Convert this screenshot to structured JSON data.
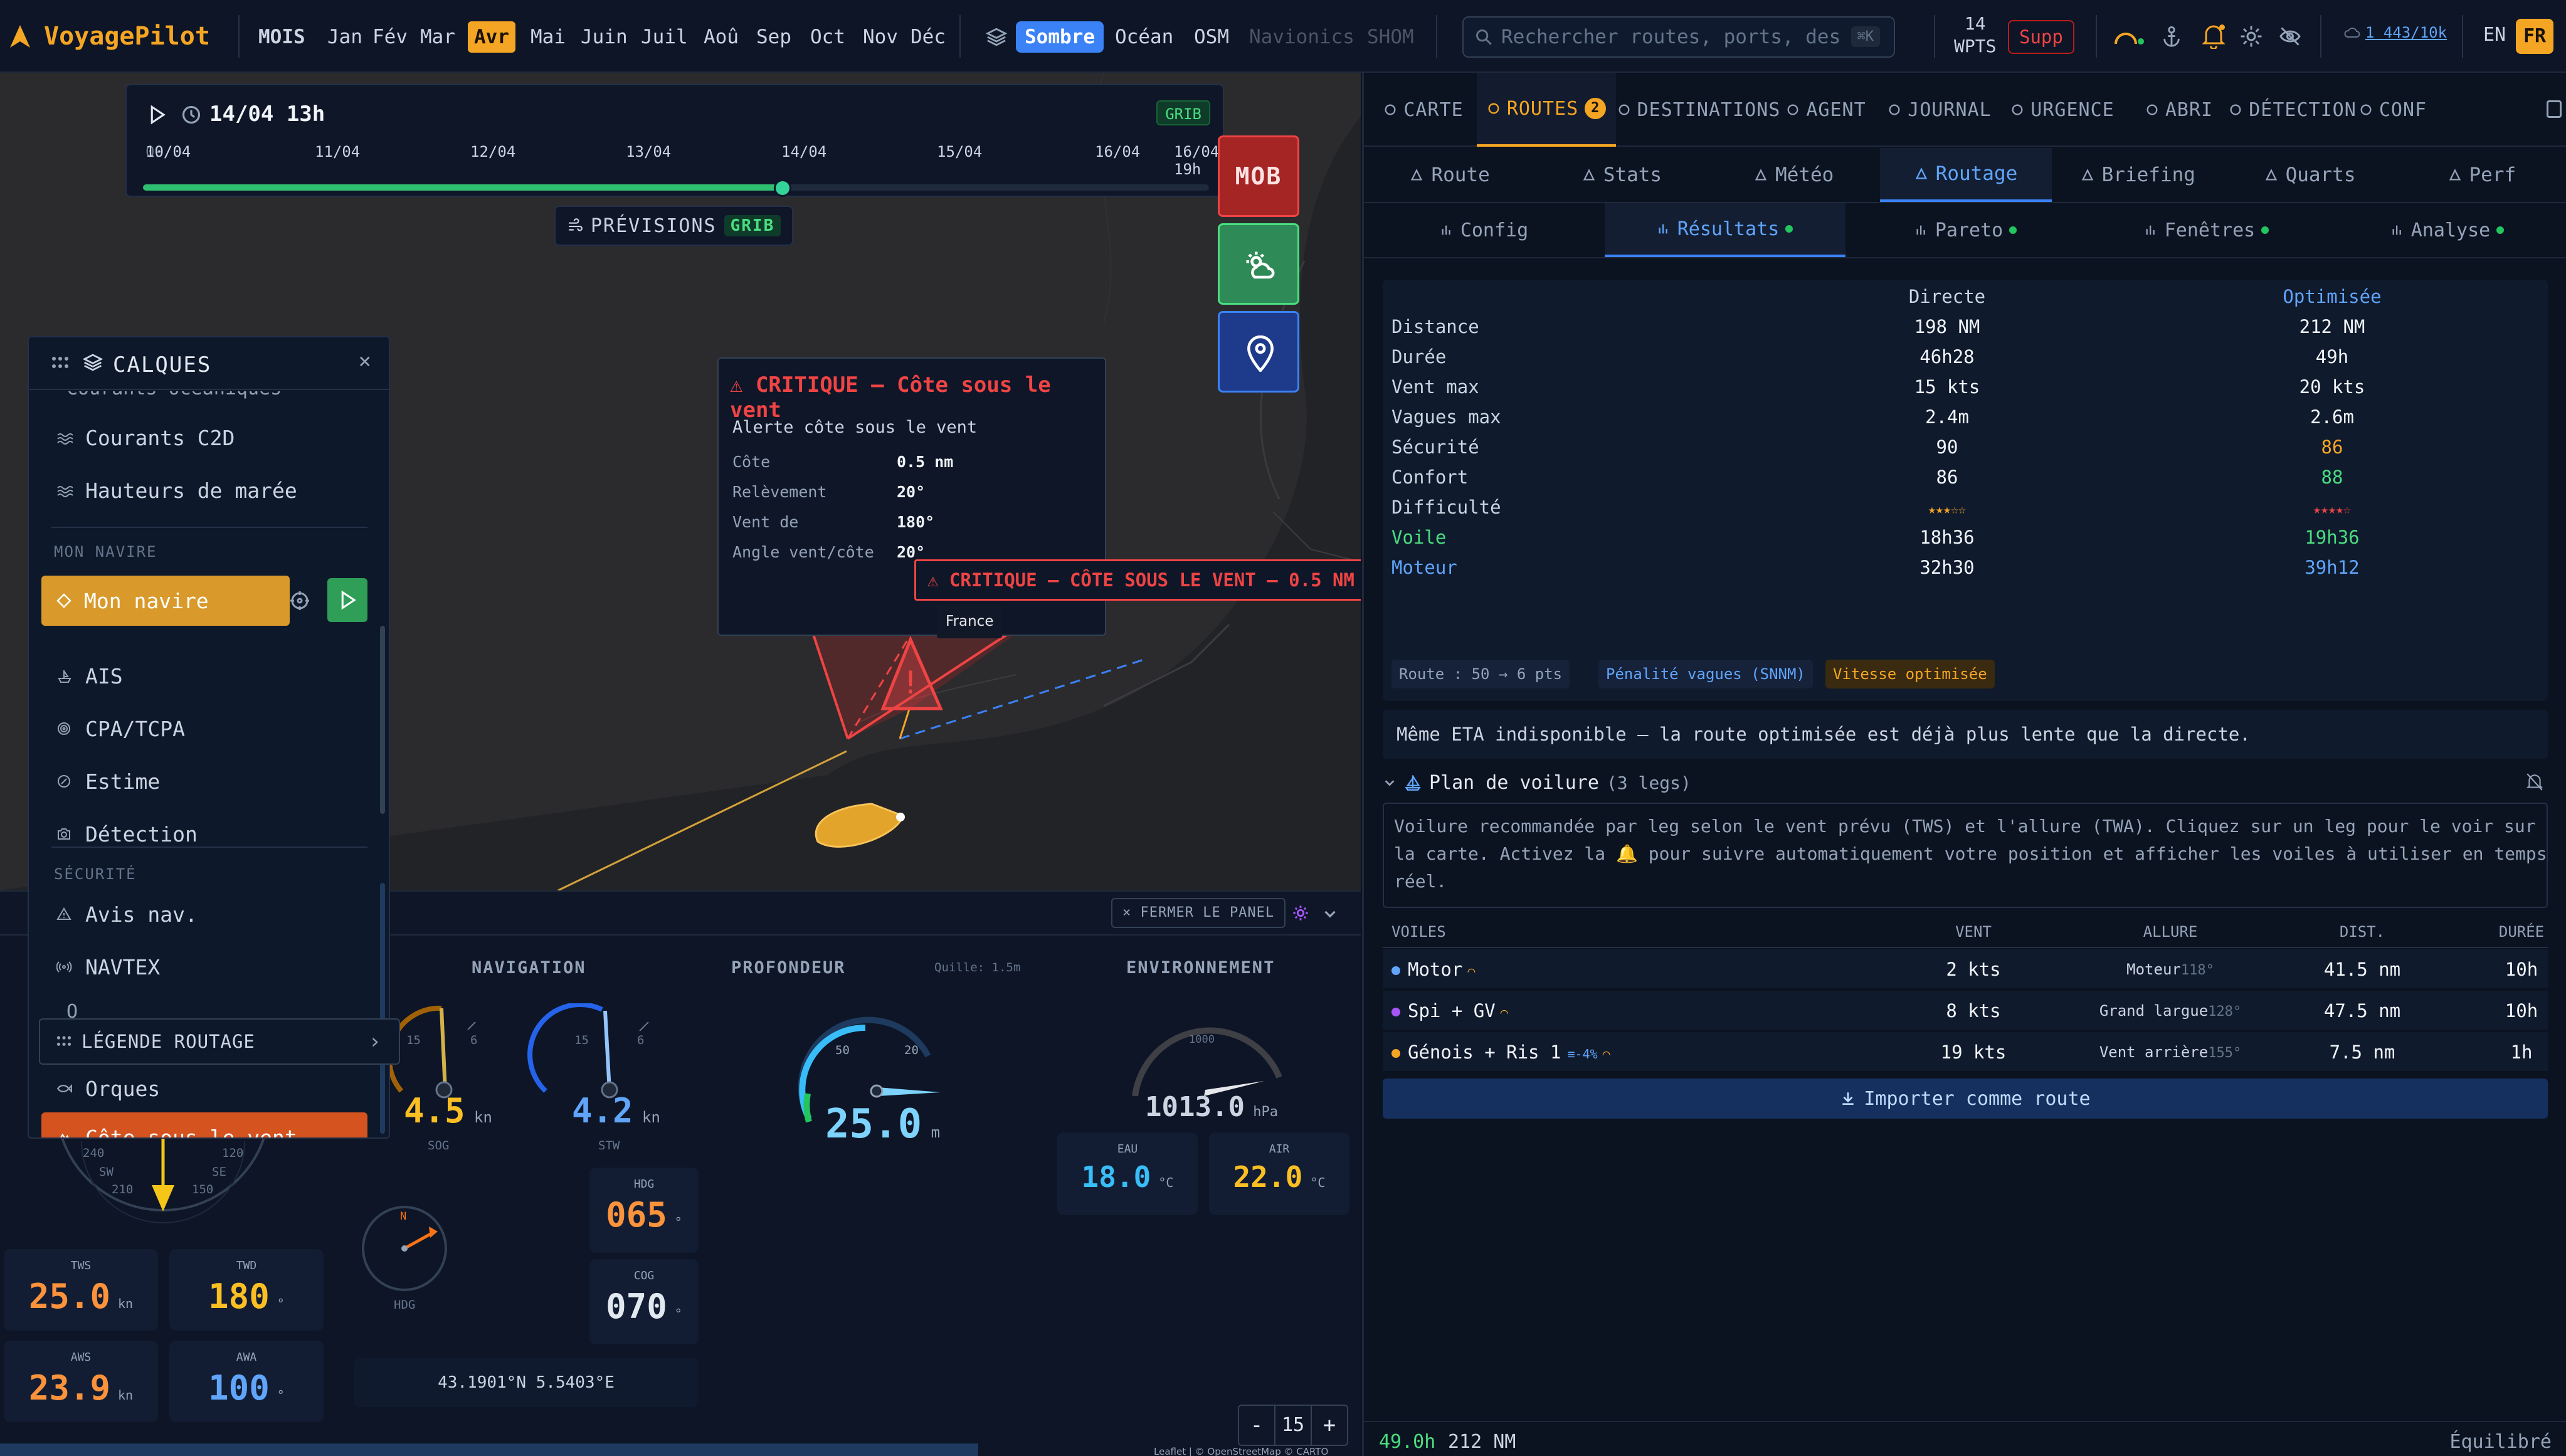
{
  "app": {
    "name": "VoyagePilot",
    "brand_color": "#f5a524"
  },
  "months": {
    "label": "MOIS",
    "items": [
      "Jan",
      "Fév",
      "Mar",
      "Avr",
      "Mai",
      "Juin",
      "Juil",
      "Aoû",
      "Sep",
      "Oct",
      "Nov",
      "Déc"
    ],
    "active": "Avr"
  },
  "basemaps": {
    "items": [
      "Sombre",
      "Océan",
      "OSM",
      "Navionics",
      "SHOM"
    ],
    "active": "Sombre"
  },
  "search": {
    "placeholder": "Rechercher routes, ports, destin",
    "shortcut": "⌘K"
  },
  "waypoints": {
    "count": "14",
    "label": "WPTS",
    "delete": "Supp"
  },
  "quota": "1 443/10k",
  "languages": [
    "EN",
    "FR"
  ],
  "active_language": "FR",
  "timeline": {
    "current": "14/04 13h",
    "badge": "GRIB",
    "ticks": [
      "10/04",
      "11/04",
      "12/04",
      "13/04",
      "14/04",
      "15/04",
      "16/04",
      "16/04 19h"
    ],
    "overlap_tick": "09/04",
    "progress": 0.6
  },
  "forecast": {
    "label": "PRÉVISIONS",
    "badge": "GRIB"
  },
  "mob": "MOB",
  "alert": {
    "title": "⚠ CRITIQUE — Côte sous le vent",
    "subtitle": "Alerte côte sous le vent",
    "rows": [
      {
        "k": "Côte",
        "v": "0.5 nm"
      },
      {
        "k": "Relèvement",
        "v": "20°"
      },
      {
        "k": "Vent de",
        "v": "180°"
      },
      {
        "k": "Angle vent/côte",
        "v": "20°"
      }
    ],
    "banner": "⚠ CRITIQUE — CÔTE SOUS LE VENT — 0.5 NM",
    "place": "France"
  },
  "layers": {
    "title": "CALQUES",
    "close": "×",
    "cut_top": "Courants océaniques",
    "items_top": [
      "Courants C2D",
      "Hauteurs de marée"
    ],
    "sec_boat": "MON NAVIRE",
    "boat": "Mon navire",
    "items_boat": [
      "AIS",
      "CPA/TCPA",
      "Estime",
      "Détection"
    ],
    "sec_safety": "SÉCURITÉ",
    "items_safety": [
      "Avis nav.",
      "NAVTEX"
    ],
    "hidden_item": "O",
    "orcas": "Orques",
    "lee_shore": "Côte sous le vent"
  },
  "legend": {
    "label": "LÉGENDE ROUTAGE",
    "arrow": "›"
  },
  "dashboard": {
    "close_panel": "× FERMER LE PANEL",
    "navigation": "NAVIGATION",
    "depth": "PROFONDEUR",
    "keel": "Quille: 1.5m",
    "environment": "ENVIRONNEMENT",
    "sog": "4.5",
    "sog_unit": "kn",
    "sog_label": "SOG",
    "stw": "4.2",
    "stw_unit": "kn",
    "stw_label": "STW",
    "gauge_15": "15",
    "gauge_6": "6",
    "depth_val": "25.0",
    "depth_unit": "m",
    "depth_50": "50",
    "depth_20": "20",
    "pressure": "1013.0",
    "pressure_unit": "hPa",
    "pressure_1000": "1000",
    "hdg_label": "HDG",
    "hdg": "065",
    "cog_label": "COG",
    "cog": "070",
    "deg": "°",
    "compass_n": "N",
    "compass_hdg": "HDG",
    "position": "43.1901°N 5.5403°E",
    "eau_label": "EAU",
    "eau": "18.0",
    "air_label": "AIR",
    "air": "22.0",
    "temp_unit": "°C",
    "tws_label": "TWS",
    "tws": "25.0",
    "twd_label": "TWD",
    "twd": "180",
    "aws_label": "AWS",
    "aws": "23.9",
    "awa_label": "AWA",
    "awa": "100",
    "kn": "kn",
    "wind_ticks": [
      "240",
      "120",
      "SW",
      "SE",
      "210",
      "150"
    ],
    "zoom": "15",
    "zoom_minus": "-",
    "zoom_plus": "+",
    "attribution": "Leaflet | © OpenStreetMap © CARTO"
  },
  "tabs_main": [
    {
      "label": "CARTE"
    },
    {
      "label": "ROUTES",
      "badge": "2"
    },
    {
      "label": "DESTINATIONS"
    },
    {
      "label": "AGENT"
    },
    {
      "label": "JOURNAL"
    },
    {
      "label": "URGENCE"
    },
    {
      "label": "ABRI"
    },
    {
      "label": "DÉTECTION"
    },
    {
      "label": "CONF"
    }
  ],
  "tabs_sub": [
    "Route",
    "Stats",
    "Météo",
    "Routage",
    "Briefing",
    "Quarts",
    "Perf"
  ],
  "tabs_results": [
    "Config",
    "Résultats",
    "Pareto",
    "Fenêtres",
    "Analyse"
  ],
  "comparison": {
    "col_direct": "Directe",
    "col_opt": "Optimisée",
    "rows": [
      {
        "label": "Distance",
        "d": "198 NM",
        "o": "212 NM"
      },
      {
        "label": "Durée",
        "d": "46h28",
        "o": "49h"
      },
      {
        "label": "Vent max",
        "d": "15 kts",
        "o": "20 kts"
      },
      {
        "label": "Vagues max",
        "d": "2.4m",
        "o": "2.6m"
      },
      {
        "label": "Sécurité",
        "d": "90",
        "o": "86"
      },
      {
        "label": "Confort",
        "d": "86",
        "o": "88"
      },
      {
        "label": "Difficulté",
        "d": "★★★☆☆",
        "o": "★★★★☆"
      },
      {
        "label": "Voile",
        "d": "18h36",
        "o": "19h36"
      },
      {
        "label": "Moteur",
        "d": "32h30",
        "o": "39h12"
      }
    ],
    "chips": [
      "Route : 50 → 6 pts",
      "Pénalité vagues (SNNM)",
      "Vitesse optimisée"
    ]
  },
  "eta_note": "Même ETA indisponible — la route optimisée est déjà plus lente que la directe.",
  "sail_plan": {
    "title": "Plan de voilure",
    "count": "(3 legs)",
    "desc_1": "Voilure recommandée par leg selon le vent prévu (TWS) et l'allure (TWA). Cliquez sur un leg pour le voir sur",
    "desc_2": "la carte. Activez la 🔔 pour suivre automatiquement votre position et afficher les voiles à utiliser en temps",
    "desc_3": "réel.",
    "headers": [
      "VOILES",
      "VENT",
      "ALLURE",
      "DIST.",
      "DURÉE"
    ],
    "legs": [
      {
        "sail": "Motor",
        "wind": "2 kts",
        "pos": "Moteur",
        "angle": "118°",
        "dist": "41.5 nm",
        "dur": "10h",
        "color": "#60a5fa"
      },
      {
        "sail": "Spi + GV",
        "wind": "8 kts",
        "pos": "Grand largue",
        "angle": "128°",
        "dist": "47.5 nm",
        "dur": "10h",
        "color": "#a855f7"
      },
      {
        "sail": "Génois + Ris 1",
        "extra": "≡-4%",
        "wind": "19 kts",
        "pos": "Vent arrière",
        "angle": "155°",
        "dist": "7.5 nm",
        "dur": "1h",
        "color": "#f5a524"
      }
    ],
    "import": "Importer comme route"
  },
  "footer": {
    "time": "49.0h",
    "dist": "212 NM",
    "mode": "Équilibré"
  }
}
